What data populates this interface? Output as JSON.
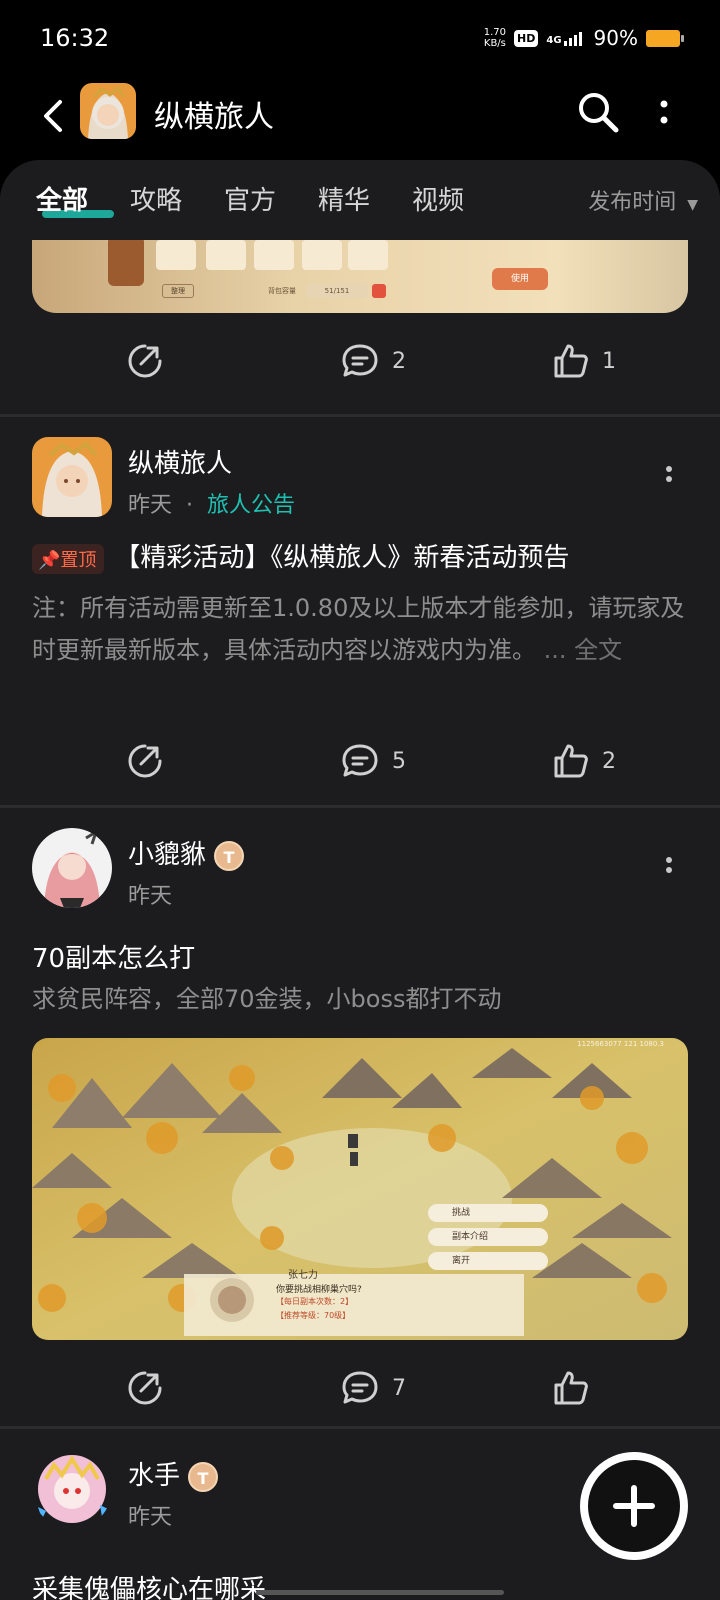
{
  "status": {
    "time": "16:32",
    "net_speed_top": "1.70",
    "net_speed_bottom": "KB/s",
    "hd": "HD",
    "network": "4G",
    "battery": "90%"
  },
  "appbar": {
    "title": "纵横旅人",
    "icons": [
      "back-icon",
      "search-icon",
      "more-vertical-icon"
    ]
  },
  "tabs": {
    "items": [
      "全部",
      "攻略",
      "官方",
      "精华",
      "视频"
    ],
    "sort_label": "发布时间",
    "accent": "#1ec0b2"
  },
  "top_card_image": {
    "slot_btn": "整理",
    "capacity_label": "背包容量",
    "capacity_value": "51/151",
    "use_btn": "使用"
  },
  "posts": [
    {
      "share": "",
      "comments": "2",
      "likes": "1"
    },
    {
      "author": "纵横旅人",
      "time": "昨天",
      "category": "旅人公告",
      "pinned": "置顶",
      "title": "【精彩活动】《纵横旅人》新春活动预告",
      "body": "注：所有活动需更新至1.0.80及以上版本才能参加，请玩家及时更新最新版本，具体活动内容以游戏内为准。",
      "more": "... 全文",
      "comments": "5",
      "likes": "2"
    },
    {
      "author": "小貔貅",
      "badge": "T",
      "time": "昨天",
      "title": "70副本怎么打",
      "body": "求贫民阵容，全部70金装，小boss都打不动",
      "comments": "7",
      "likes": "",
      "image": {
        "coords": "1125663077 121 1080.3",
        "menu": [
          "挑战",
          "副本介绍",
          "离开"
        ],
        "npc_name": "张七力",
        "dialog": "你要挑战相柳巢穴吗?",
        "line1": "【每日副本次数：2】",
        "line2": "【推荐等级：70级】"
      }
    },
    {
      "author": "水手",
      "badge": "T",
      "time": "昨天",
      "title": "采集傀儡核心在哪采"
    }
  ]
}
